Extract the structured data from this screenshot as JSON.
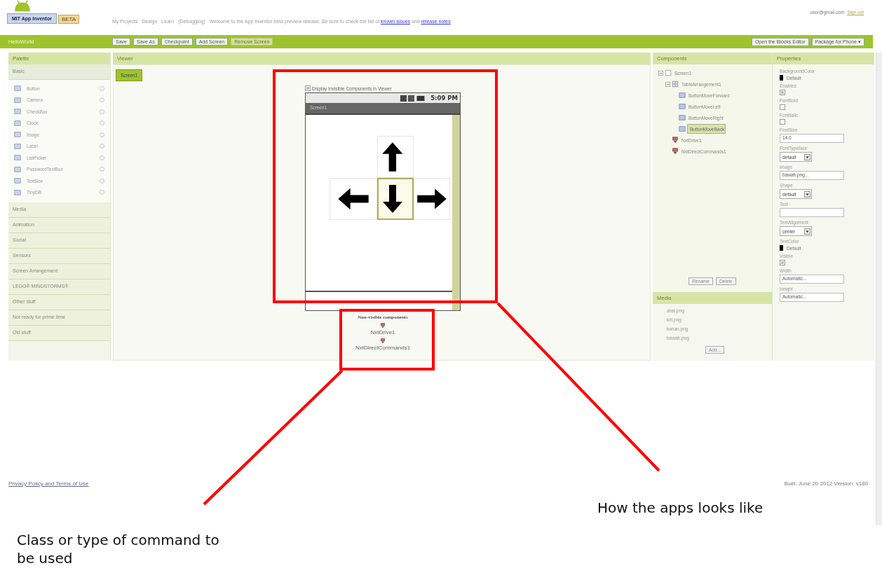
{
  "header": {
    "logo": "MIT App Inventor",
    "badge": "BETA",
    "nav": [
      "My Projects",
      "Design",
      "Learn",
      "(Debugging)"
    ],
    "notice": "Welcome to the App Inventor beta preview release. Be sure to check the list of",
    "links": [
      "known issues",
      "release notes"
    ],
    "joiner": "and",
    "account": "user@gmail.com",
    "sign_out": "Sign out"
  },
  "toolbar": {
    "project": "HelloWorld",
    "buttons": [
      {
        "label": "Save",
        "disabled": false
      },
      {
        "label": "Save As",
        "disabled": false
      },
      {
        "label": "Checkpoint",
        "disabled": false
      },
      {
        "label": "Add Screen",
        "disabled": false
      },
      {
        "label": "Remove Screen",
        "disabled": true
      }
    ],
    "right_buttons": [
      "Open the Blocks Editor",
      "Package for Phone ▾"
    ]
  },
  "palette": {
    "title": "Palette",
    "open_category": "Basic",
    "items": [
      "Button",
      "Camera",
      "CheckBox",
      "Clock",
      "Image",
      "Label",
      "ListPicker",
      "PasswordTextBox",
      "TextBox",
      "TinyDB"
    ],
    "categories": [
      "Media",
      "Animation",
      "Social",
      "Sensors",
      "Screen Arrangement",
      "LEGO® MINDSTORMS®",
      "Other stuff",
      "Not ready for prime time",
      "Old stuff"
    ]
  },
  "viewer": {
    "title": "Viewer",
    "screen_tab": "Screen1",
    "display_invisible": {
      "label": "Display Invisible Components in Viewer",
      "checked": true
    },
    "phone": {
      "time": "5:09 PM",
      "title": "Screen1"
    },
    "arrow_buttons": [
      {
        "kind": "empty"
      },
      {
        "kind": "up",
        "selected": false
      },
      {
        "kind": "empty"
      },
      {
        "kind": "left",
        "selected": false
      },
      {
        "kind": "down",
        "selected": true
      },
      {
        "kind": "right",
        "selected": false
      }
    ],
    "nonvisible_title": "Non-visible components",
    "nonvisible": [
      "NxtDrive1",
      "NxtDirectCommands1"
    ]
  },
  "components": {
    "title": "Components",
    "tree": [
      {
        "label": "Screen1",
        "kind": "screen",
        "selected": false,
        "expanded": true,
        "children": [
          {
            "label": "TableArrangement1",
            "kind": "arrangement",
            "selected": false,
            "expanded": true,
            "children": [
              {
                "label": "ButtonMoveForward",
                "kind": "button",
                "selected": false
              },
              {
                "label": "ButtonMoveLeft",
                "kind": "button",
                "selected": false
              },
              {
                "label": "ButtonMoveRight",
                "kind": "button",
                "selected": false
              },
              {
                "label": "ButtonMoveBack",
                "kind": "button",
                "selected": true
              }
            ]
          },
          {
            "label": "NxtDrive1",
            "kind": "nxt",
            "selected": false
          },
          {
            "label": "NxtDirectCommands1",
            "kind": "nxt",
            "selected": false
          }
        ]
      }
    ],
    "buttons": [
      "Rename",
      "Delete"
    ]
  },
  "media": {
    "title": "Media",
    "files": [
      "atas.png",
      "kiri.png",
      "kanan.png",
      "bawah.png"
    ],
    "add": "Add..."
  },
  "properties": {
    "title": "Properties",
    "items": [
      {
        "label": "BackgroundColor",
        "kind": "color",
        "value": "Default"
      },
      {
        "label": "Enabled",
        "kind": "checkbox",
        "checked": true
      },
      {
        "label": "FontBold",
        "kind": "checkbox",
        "checked": false
      },
      {
        "label": "FontItalic",
        "kind": "checkbox",
        "checked": false
      },
      {
        "label": "FontSize",
        "kind": "text",
        "value": "14.0"
      },
      {
        "label": "FontTypeface",
        "kind": "select",
        "value": "default"
      },
      {
        "label": "Image",
        "kind": "text",
        "value": "bawah.png..."
      },
      {
        "label": "Shape",
        "kind": "select",
        "value": "default"
      },
      {
        "label": "Text",
        "kind": "text"
      },
      {
        "label": "TextAlignment",
        "kind": "select",
        "value": "center"
      },
      {
        "label": "TextColor",
        "kind": "color",
        "value": "Default"
      },
      {
        "label": "Visible",
        "kind": "checkbox",
        "checked": true
      },
      {
        "label": "Width",
        "kind": "text",
        "value": "Automatic..."
      },
      {
        "label": "Height",
        "kind": "text",
        "value": "Automatic..."
      }
    ]
  },
  "footer": {
    "privacy": "Privacy Policy and Terms of Use",
    "build": "Built: June 20 2012 Version: v180"
  },
  "annotations": [
    {
      "text": "How the apps looks like"
    },
    {
      "text": "Class or type of command to be used"
    }
  ]
}
